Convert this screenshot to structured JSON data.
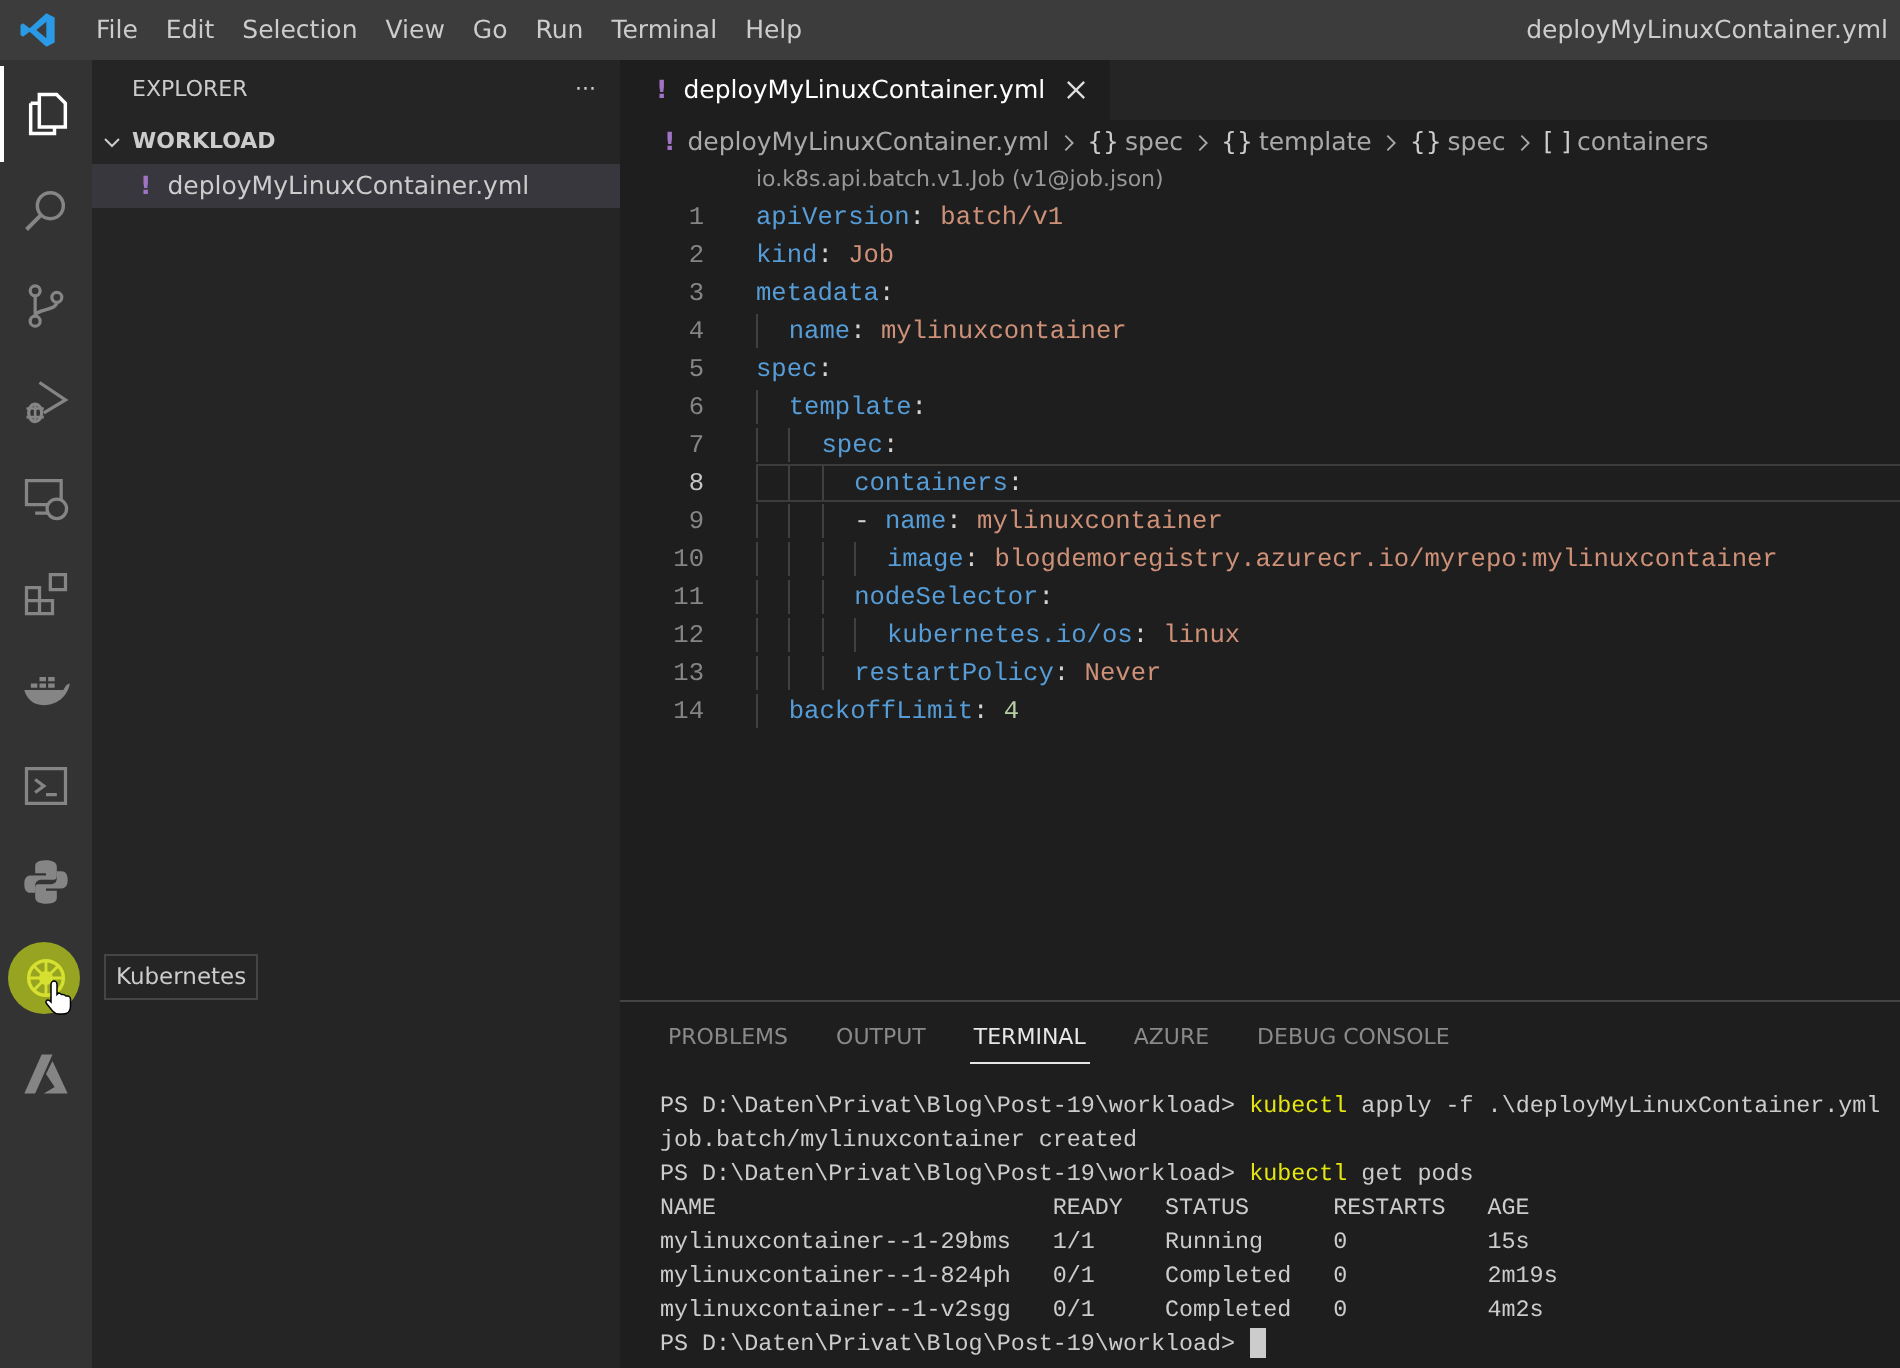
{
  "title_bar": {
    "menu": [
      "File",
      "Edit",
      "Selection",
      "View",
      "Go",
      "Run",
      "Terminal",
      "Help"
    ],
    "title": "deployMyLinuxContainer.yml"
  },
  "activity_bar": {
    "items": [
      {
        "kind": "explorer",
        "selected": true,
        "hovered": false
      },
      {
        "kind": "search",
        "selected": false,
        "hovered": false
      },
      {
        "kind": "source-control",
        "selected": false,
        "hovered": false
      },
      {
        "kind": "run-debug",
        "selected": false,
        "hovered": false
      },
      {
        "kind": "remote",
        "selected": false,
        "hovered": false
      },
      {
        "kind": "extensions",
        "selected": false,
        "hovered": false
      },
      {
        "kind": "docker",
        "selected": false,
        "hovered": false
      },
      {
        "kind": "terminal",
        "selected": false,
        "hovered": false
      },
      {
        "kind": "python",
        "selected": false,
        "hovered": false
      },
      {
        "kind": "kubernetes",
        "selected": false,
        "hovered": true,
        "tooltip": "Kubernetes"
      },
      {
        "kind": "azure",
        "selected": false,
        "hovered": false
      }
    ]
  },
  "sidebar": {
    "title": "EXPLORER",
    "more": "···",
    "section": {
      "label": "WORKLOAD",
      "expanded": true,
      "files": [
        {
          "icon": "!",
          "name": "deployMyLinuxContainer.yml",
          "selected": true
        }
      ]
    }
  },
  "editor": {
    "tabs": [
      {
        "icon": "!",
        "label": "deployMyLinuxContainer.yml",
        "selected": true
      }
    ],
    "breadcrumb": [
      {
        "icon": "!",
        "label": "deployMyLinuxContainer.yml"
      },
      {
        "icon": "{}",
        "label": "spec"
      },
      {
        "icon": "{}",
        "label": "template"
      },
      {
        "icon": "{}",
        "label": "spec"
      },
      {
        "icon": "[ ]",
        "label": "containers"
      }
    ],
    "codelens": "io.k8s.api.batch.v1.Job (v1@job.json)",
    "lines": [
      {
        "number": "1",
        "current": false,
        "tokens": [
          {
            "kind": "key",
            "text": "apiVersion"
          },
          {
            "kind": "punct",
            "text": ": "
          },
          {
            "kind": "string",
            "text": "batch/v1"
          }
        ]
      },
      {
        "number": "2",
        "current": false,
        "tokens": [
          {
            "kind": "key",
            "text": "kind"
          },
          {
            "kind": "punct",
            "text": ": "
          },
          {
            "kind": "string",
            "text": "Job"
          }
        ]
      },
      {
        "number": "3",
        "current": false,
        "tokens": [
          {
            "kind": "key",
            "text": "metadata"
          },
          {
            "kind": "punct",
            "text": ":"
          }
        ]
      },
      {
        "number": "4",
        "current": false,
        "tokens": [
          {
            "kind": "key",
            "text": "  name"
          },
          {
            "kind": "punct",
            "text": ": "
          },
          {
            "kind": "string",
            "text": "mylinuxcontainer"
          }
        ]
      },
      {
        "number": "5",
        "current": false,
        "tokens": [
          {
            "kind": "key",
            "text": "spec"
          },
          {
            "kind": "punct",
            "text": ":"
          }
        ]
      },
      {
        "number": "6",
        "current": false,
        "tokens": [
          {
            "kind": "key",
            "text": "  template"
          },
          {
            "kind": "punct",
            "text": ":"
          }
        ]
      },
      {
        "number": "7",
        "current": false,
        "tokens": [
          {
            "kind": "key",
            "text": "    spec"
          },
          {
            "kind": "punct",
            "text": ":"
          }
        ]
      },
      {
        "number": "8",
        "current": true,
        "tokens": [
          {
            "kind": "key",
            "text": "      containers"
          },
          {
            "kind": "punct",
            "text": ":"
          }
        ]
      },
      {
        "number": "9",
        "current": false,
        "tokens": [
          {
            "kind": "punct",
            "text": "      - "
          },
          {
            "kind": "key",
            "text": "name"
          },
          {
            "kind": "punct",
            "text": ": "
          },
          {
            "kind": "string",
            "text": "mylinuxcontainer"
          }
        ]
      },
      {
        "number": "10",
        "current": false,
        "tokens": [
          {
            "kind": "key",
            "text": "        image"
          },
          {
            "kind": "punct",
            "text": ": "
          },
          {
            "kind": "string",
            "text": "blogdemoregistry.azurecr.io/myrepo:mylinuxcontainer"
          }
        ]
      },
      {
        "number": "11",
        "current": false,
        "tokens": [
          {
            "kind": "key",
            "text": "      nodeSelector"
          },
          {
            "kind": "punct",
            "text": ":"
          }
        ]
      },
      {
        "number": "12",
        "current": false,
        "tokens": [
          {
            "kind": "key",
            "text": "        kubernetes.io/os"
          },
          {
            "kind": "punct",
            "text": ": "
          },
          {
            "kind": "string",
            "text": "linux"
          }
        ]
      },
      {
        "number": "13",
        "current": false,
        "tokens": [
          {
            "kind": "key",
            "text": "      restartPolicy"
          },
          {
            "kind": "punct",
            "text": ": "
          },
          {
            "kind": "string",
            "text": "Never"
          }
        ]
      },
      {
        "number": "14",
        "current": false,
        "tokens": [
          {
            "kind": "key",
            "text": "  backoffLimit"
          },
          {
            "kind": "punct",
            "text": ": "
          },
          {
            "kind": "number",
            "text": "4"
          }
        ]
      }
    ]
  },
  "panel": {
    "tabs": [
      {
        "label": "PROBLEMS",
        "selected": false
      },
      {
        "label": "OUTPUT",
        "selected": false
      },
      {
        "label": "TERMINAL",
        "selected": true
      },
      {
        "label": "AZURE",
        "selected": false
      },
      {
        "label": "DEBUG CONSOLE",
        "selected": false
      }
    ],
    "terminal": [
      {
        "kind": "prompt",
        "prompt": "PS D:\\Daten\\Privat\\Blog\\Post-19\\workload>",
        "command": "kubectl",
        "args": "apply -f .\\deployMyLinuxContainer.yml",
        "cursor": false
      },
      {
        "kind": "output",
        "text": "job.batch/mylinuxcontainer created"
      },
      {
        "kind": "prompt",
        "prompt": "PS D:\\Daten\\Privat\\Blog\\Post-19\\workload>",
        "command": "kubectl",
        "args": "get pods",
        "cursor": false
      },
      {
        "kind": "table",
        "columns": [
          "NAME",
          "READY",
          "STATUS",
          "RESTARTS",
          "AGE"
        ],
        "rows": [
          [
            "mylinuxcontainer--1-29bms",
            "1/1",
            "Running",
            "0",
            "15s"
          ],
          [
            "mylinuxcontainer--1-824ph",
            "0/1",
            "Completed",
            "0",
            "2m19s"
          ],
          [
            "mylinuxcontainer--1-v2sgg",
            "0/1",
            "Completed",
            "0",
            "4m2s"
          ]
        ]
      },
      {
        "kind": "prompt",
        "prompt": "PS D:\\Daten\\Privat\\Blog\\Post-19\\workload>",
        "cursor": true
      }
    ]
  }
}
